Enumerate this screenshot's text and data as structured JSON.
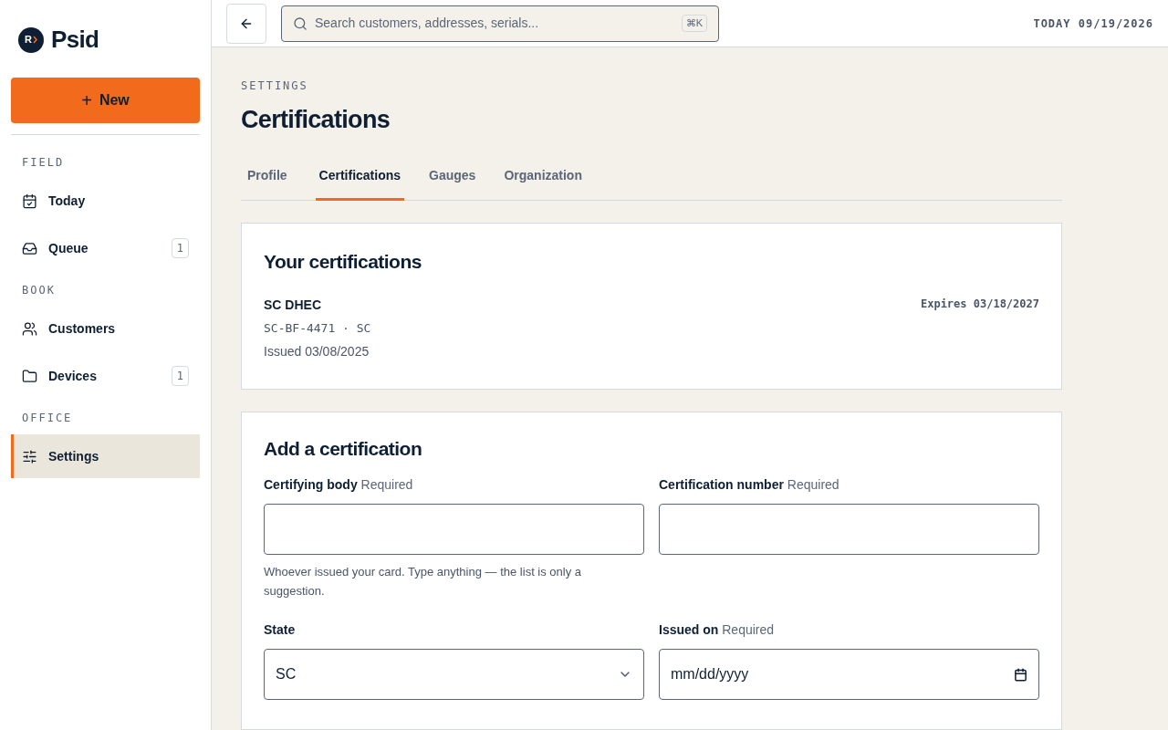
{
  "brand": {
    "name": "Psid",
    "mark": "R"
  },
  "new_button": {
    "icon": "+",
    "label": "New"
  },
  "sidebar": {
    "sections": [
      {
        "title": "FIELD",
        "items": [
          {
            "label": "Today",
            "selected": false
          },
          {
            "label": "Queue",
            "badge": "1",
            "selected": false
          }
        ]
      },
      {
        "title": "BOOK",
        "items": [
          {
            "label": "Customers",
            "selected": false
          },
          {
            "label": "Devices",
            "badge": "1",
            "selected": false
          }
        ]
      },
      {
        "title": "OFFICE",
        "items": [
          {
            "label": "Settings",
            "selected": true
          }
        ]
      }
    ]
  },
  "topbar": {
    "search": {
      "placeholder": "Search customers, addresses, serials...",
      "shortcut": "⌘K"
    },
    "date": "TODAY 09/19/2026"
  },
  "page": {
    "eyebrow": "SETTINGS",
    "title": "Certifications"
  },
  "tabs": [
    {
      "label": "Profile",
      "selected": false
    },
    {
      "label": "Certifications",
      "selected": true
    },
    {
      "label": "Gauges",
      "selected": false
    },
    {
      "label": "Organization",
      "selected": false
    }
  ],
  "certifications": {
    "title": "Your certifications",
    "items": [
      {
        "body": "SC DHEC",
        "number": "SC-BF-4471 · SC",
        "issued": "Issued 03/08/2025",
        "expires": "Expires 03/18/2027"
      }
    ]
  },
  "add_form": {
    "title": "Add a certification",
    "fields": [
      {
        "kind": "text",
        "label": "Certifying body",
        "required": "Required",
        "help": "Whoever issued your card. Type anything — the list is only a suggestion."
      },
      {
        "kind": "text",
        "label": "Certification number",
        "required": "Required"
      },
      {
        "kind": "select",
        "label": "State",
        "value": "SC"
      },
      {
        "kind": "date",
        "label": "Issued on",
        "required": "Required",
        "placeholder": "mm/dd/yyyy"
      }
    ]
  }
}
